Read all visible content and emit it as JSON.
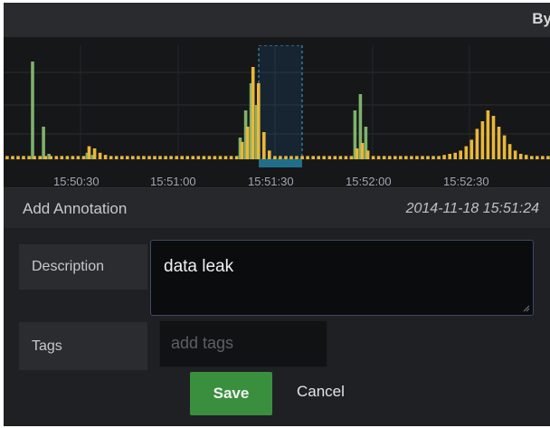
{
  "topbar": {
    "partial_text": "By"
  },
  "graph": {
    "x_ticks": [
      "15:50:30",
      "15:51:00",
      "15:51:30",
      "15:52:00",
      "15:52:30"
    ],
    "colors": {
      "green": "#7eb26d",
      "yellow": "#eab839",
      "selection": "#1f78c1"
    }
  },
  "chart_data": {
    "type": "bar",
    "x_ticks": [
      "15:50:30",
      "15:51:00",
      "15:51:30",
      "15:52:00",
      "15:52:30"
    ],
    "series": [
      {
        "values": [
          0,
          0,
          0,
          0,
          0,
          90,
          0,
          30,
          5,
          0,
          0,
          0,
          0,
          0,
          0,
          6,
          4,
          0,
          0,
          0,
          0,
          0,
          0,
          0,
          0,
          0,
          0,
          0,
          0,
          0,
          0,
          0,
          0,
          0,
          0,
          0,
          0,
          0,
          0,
          0,
          0,
          0,
          0,
          20,
          45,
          70,
          50,
          0,
          0,
          0,
          0,
          0,
          0,
          0,
          0,
          0,
          0,
          0,
          0,
          0,
          0,
          0,
          0,
          0,
          45,
          60,
          30,
          0,
          0,
          0,
          0,
          0,
          0,
          0,
          0,
          0,
          0,
          0,
          0,
          0,
          0,
          0,
          0,
          0,
          0,
          0,
          0,
          0,
          0,
          0,
          0,
          0,
          0,
          0,
          0,
          0,
          0,
          0,
          0,
          0
        ]
      },
      {
        "values": [
          3,
          3,
          3,
          3,
          3,
          3,
          3,
          3,
          3,
          3,
          3,
          3,
          3,
          3,
          3,
          12,
          10,
          6,
          4,
          3,
          3,
          3,
          3,
          3,
          3,
          3,
          3,
          3,
          3,
          3,
          3,
          3,
          3,
          3,
          3,
          3,
          3,
          3,
          3,
          3,
          3,
          3,
          3,
          16,
          30,
          85,
          70,
          25,
          8,
          3,
          3,
          3,
          3,
          3,
          3,
          3,
          3,
          3,
          3,
          3,
          3,
          3,
          3,
          3,
          10,
          15,
          8,
          3,
          3,
          3,
          3,
          3,
          3,
          3,
          3,
          3,
          3,
          3,
          3,
          3,
          4,
          5,
          6,
          8,
          12,
          18,
          28,
          35,
          45,
          40,
          30,
          22,
          14,
          8,
          5,
          4,
          3,
          3,
          3,
          3
        ]
      }
    ]
  },
  "annotation": {
    "title": "Add Annotation",
    "timestamp": "2014-11-18 15:51:24",
    "description_label": "Description",
    "description_value": "data leak",
    "tags_label": "Tags",
    "tags_placeholder": "add tags",
    "save_label": "Save",
    "cancel_label": "Cancel"
  }
}
